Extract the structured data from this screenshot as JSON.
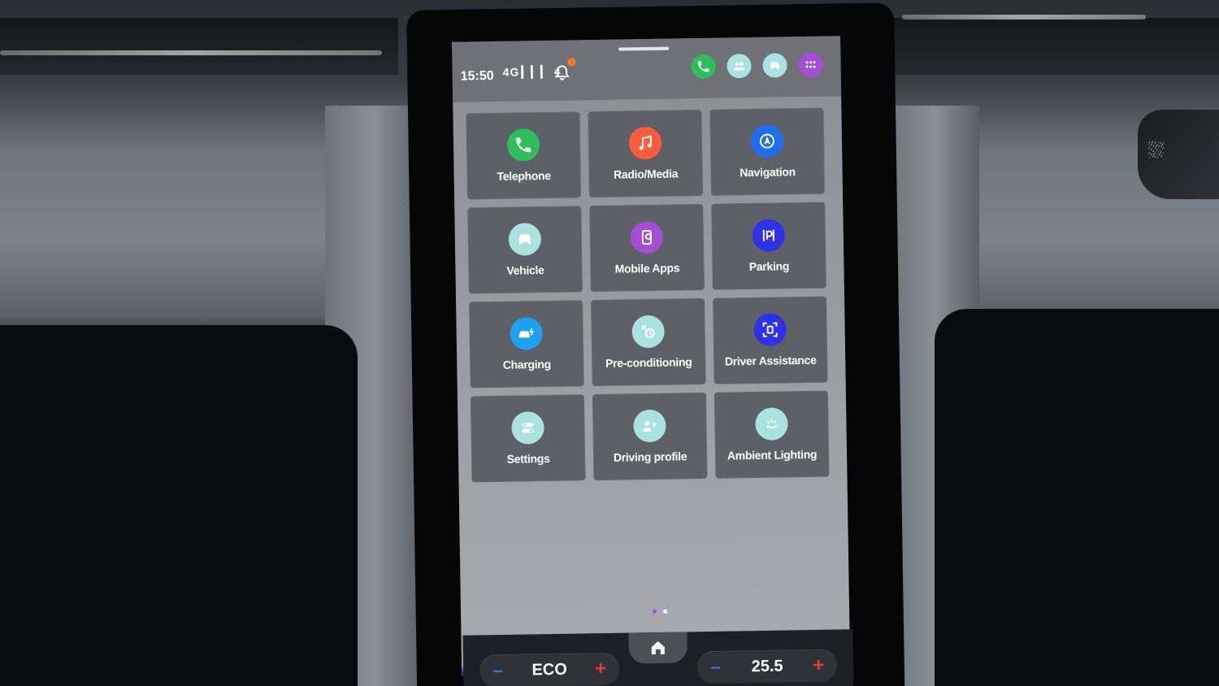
{
  "status": {
    "time": "15:50",
    "signal": "4G ▎▎▎ 4",
    "notification_color": "#ff7a1a"
  },
  "quick_icons": [
    {
      "icon": "phone-icon",
      "color": "#2fbf5a"
    },
    {
      "icon": "people-icon",
      "color": "#a9e2e0"
    },
    {
      "icon": "car-icon",
      "color": "#a9e2e0"
    },
    {
      "icon": "app-grid-icon",
      "color": "#a44ed6"
    }
  ],
  "apps": [
    {
      "label": "Telephone",
      "icon": "phone-icon",
      "color": "#2fbf5a"
    },
    {
      "label": "Radio/Media",
      "icon": "music-note-icon",
      "color": "#ff5a3c"
    },
    {
      "label": "Navigation",
      "icon": "navigation-arrow-icon",
      "color": "#1e6ff0"
    },
    {
      "label": "Vehicle",
      "icon": "car-icon",
      "color": "#a9e2e0"
    },
    {
      "label": "Mobile Apps",
      "icon": "mobile-link-icon",
      "color": "#a44ed6"
    },
    {
      "label": "Parking",
      "icon": "parking-icon",
      "color": "#2d32e8"
    },
    {
      "label": "Charging",
      "icon": "charging-car-icon",
      "color": "#1ea2f0"
    },
    {
      "label": "Pre-conditioning",
      "icon": "climate-timer-icon",
      "color": "#a9e2e0"
    },
    {
      "label": "Driver Assistance",
      "icon": "driver-assist-icon",
      "color": "#2d32e8"
    },
    {
      "label": "Settings",
      "icon": "toggle-settings-icon",
      "color": "#a9e2e0"
    },
    {
      "label": "Driving profile",
      "icon": "driving-profile-icon",
      "color": "#a9e2e0"
    },
    {
      "label": "Ambient Lighting",
      "icon": "ambient-light-icon",
      "color": "#a9e2e0"
    }
  ],
  "pager": {
    "active_color": "#a44ed6",
    "inactive_color": "#ffffff"
  },
  "climate": {
    "left": {
      "minus": "−",
      "value": "ECO",
      "plus": "+"
    },
    "right": {
      "minus": "−",
      "value": "25.5",
      "plus": "+"
    }
  }
}
